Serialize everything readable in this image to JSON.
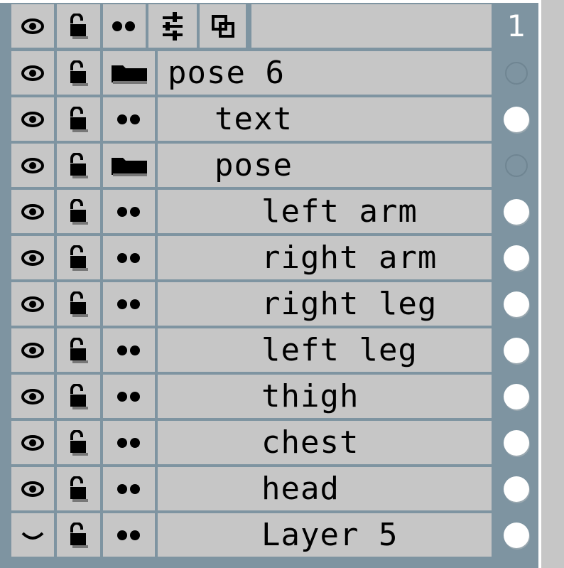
{
  "header": {
    "layer_index": "1",
    "buttons": [
      "eye-icon",
      "lock-icon",
      "dots-icon",
      "sliders-icon",
      "copy-icon"
    ]
  },
  "layers": [
    {
      "name": "pose 6",
      "type": "folder",
      "visible": true,
      "marker": "hollow"
    },
    {
      "name": "text",
      "type": "layer",
      "visible": true,
      "marker": "filled"
    },
    {
      "name": "pose",
      "type": "folder",
      "visible": true,
      "marker": "hollow"
    },
    {
      "name": "left arm",
      "type": "layer",
      "visible": true,
      "marker": "filled"
    },
    {
      "name": "right arm",
      "type": "layer",
      "visible": true,
      "marker": "filled"
    },
    {
      "name": "right leg",
      "type": "layer",
      "visible": true,
      "marker": "filled"
    },
    {
      "name": "left leg",
      "type": "layer",
      "visible": true,
      "marker": "filled"
    },
    {
      "name": "thigh",
      "type": "layer",
      "visible": true,
      "marker": "filled"
    },
    {
      "name": "chest",
      "type": "layer",
      "visible": true,
      "marker": "filled"
    },
    {
      "name": "head",
      "type": "layer",
      "visible": true,
      "marker": "filled"
    },
    {
      "name": "Layer 5",
      "type": "layer",
      "visible": false,
      "marker": "filled"
    }
  ]
}
